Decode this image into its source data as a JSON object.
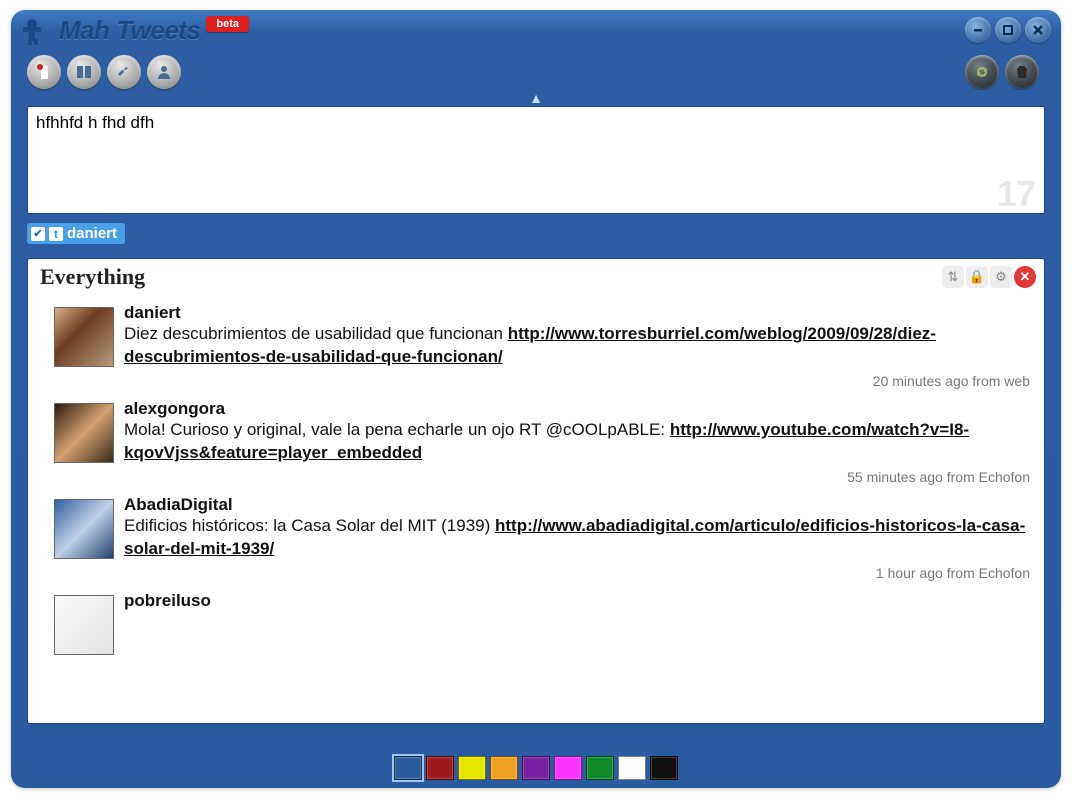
{
  "app": {
    "title": "Mah Tweets",
    "beta_label": "beta"
  },
  "compose": {
    "text": "hfhhfd h fhd dfh",
    "char_count": "17"
  },
  "account": {
    "username": "daniert"
  },
  "panel": {
    "title": "Everything"
  },
  "tweets": [
    {
      "user": "daniert",
      "text_before": "Diez descubrimientos de usabilidad que funcionan ",
      "link_text": "http://www.torresburriel.com/weblog/2009/09/28/diez-descubrimientos-de-usabilidad-que-funcionan/",
      "text_after": "",
      "meta": "20 minutes ago  from web",
      "avatar_class": "av-a"
    },
    {
      "user": "alexgongora",
      "text_before": "Mola! Curioso y original, vale la pena echarle un ojo RT @cOOLpABLE: ",
      "link_text": "http://www.youtube.com/watch?v=I8-kqovVjss&feature=player_embedded",
      "text_after": "",
      "meta": "55 minutes ago  from Echofon",
      "avatar_class": "av-b"
    },
    {
      "user": "AbadiaDigital",
      "text_before": "Edificios históricos: la Casa Solar del MIT (1939) ",
      "link_text": "http://www.abadiadigital.com/articulo/edificios-historicos-la-casa-solar-del-mit-1939/",
      "text_after": "",
      "meta": "1 hour ago  from Echofon",
      "avatar_class": "av-c"
    },
    {
      "user": "pobreiluso",
      "text_before": "",
      "link_text": "",
      "text_after": "",
      "meta": "",
      "avatar_class": "av-d"
    }
  ],
  "swatches": [
    "#2a5a9f",
    "#9e1a1a",
    "#e6e600",
    "#f0a020",
    "#7a1fa0",
    "#ff33ff",
    "#0f8b2c",
    "#ffffff",
    "#111111"
  ]
}
